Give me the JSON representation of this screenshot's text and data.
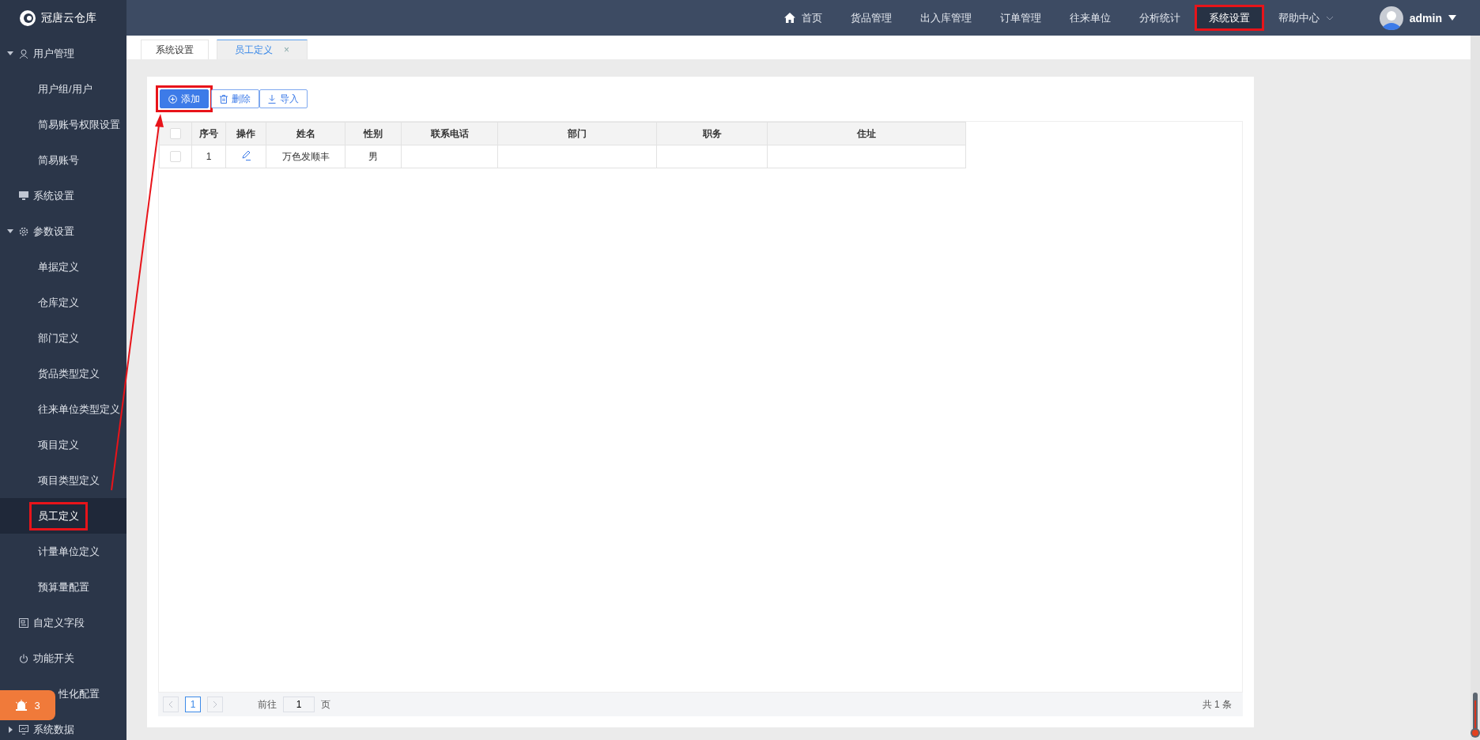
{
  "topbar": {
    "logo_text": "冠唐云仓库",
    "nav": [
      {
        "label": "首页",
        "kind": "home",
        "selected": false,
        "highlighted": false
      },
      {
        "label": "货品管理",
        "selected": false,
        "highlighted": false
      },
      {
        "label": "出入库管理",
        "selected": false,
        "highlighted": false
      },
      {
        "label": "订单管理",
        "selected": false,
        "highlighted": false
      },
      {
        "label": "往来单位",
        "selected": false,
        "highlighted": false
      },
      {
        "label": "分析统计",
        "selected": false,
        "highlighted": false
      },
      {
        "label": "系统设置",
        "selected": true,
        "highlighted": true
      },
      {
        "label": "帮助中心",
        "kind": "dropdown",
        "selected": false,
        "highlighted": false
      }
    ],
    "user": "admin"
  },
  "sidebar": {
    "items": [
      {
        "label": "用户管理",
        "kind": "user",
        "expanded": true,
        "children": [
          {
            "label": "用户组/用户",
            "selected": false,
            "highlighted": false
          },
          {
            "label": "简易账号权限设置",
            "selected": false,
            "highlighted": false
          },
          {
            "label": "简易账号",
            "selected": false,
            "highlighted": false
          }
        ]
      },
      {
        "label": "系统设置",
        "kind": "monitor"
      },
      {
        "label": "参数设置",
        "kind": "gear",
        "expanded": true,
        "children": [
          {
            "label": "单据定义",
            "selected": false,
            "highlighted": false
          },
          {
            "label": "仓库定义",
            "selected": false,
            "highlighted": false
          },
          {
            "label": "部门定义",
            "selected": false,
            "highlighted": false
          },
          {
            "label": "货品类型定义",
            "selected": false,
            "highlighted": false
          },
          {
            "label": "往来单位类型定义",
            "selected": false,
            "highlighted": false
          },
          {
            "label": "项目定义",
            "selected": false,
            "highlighted": false
          },
          {
            "label": "项目类型定义",
            "selected": false,
            "highlighted": false
          },
          {
            "label": "员工定义",
            "selected": true,
            "highlighted": true
          },
          {
            "label": "计量单位定义",
            "selected": false,
            "highlighted": false
          },
          {
            "label": "预算量配置",
            "selected": false,
            "highlighted": false
          }
        ]
      },
      {
        "label": "自定义字段",
        "kind": "form"
      },
      {
        "label": "功能开关",
        "kind": "power"
      },
      {
        "label": "性化配置"
      },
      {
        "label": "系统数据",
        "kind": "chart",
        "expanded": false
      }
    ],
    "badge": "3"
  },
  "tabs": [
    {
      "label": "系统设置",
      "selected": false,
      "closable": false
    },
    {
      "label": "员工定义",
      "selected": true,
      "closable": true,
      "close": "×"
    }
  ],
  "toolbar": [
    {
      "label": "添加",
      "kind": "primary",
      "highlighted": true
    },
    {
      "label": "删除",
      "kind": "plain",
      "highlighted": false
    },
    {
      "label": "导入",
      "kind": "plain",
      "highlighted": false
    }
  ],
  "table": {
    "all_checked": false,
    "columns": [
      "序号",
      "操作",
      "姓名",
      "性别",
      "联系电话",
      "部门",
      "职务",
      "住址"
    ],
    "rows": [
      {
        "checked": false,
        "cells": [
          "1",
          "",
          "万色发顺丰",
          "男",
          "",
          "",
          "",
          ""
        ]
      }
    ]
  },
  "pagination": {
    "pages": [
      {
        "label": "1",
        "selected": true
      }
    ],
    "goto_label": "前往",
    "goto_value": "1",
    "page_suffix": "页",
    "total": "共 1 条"
  }
}
